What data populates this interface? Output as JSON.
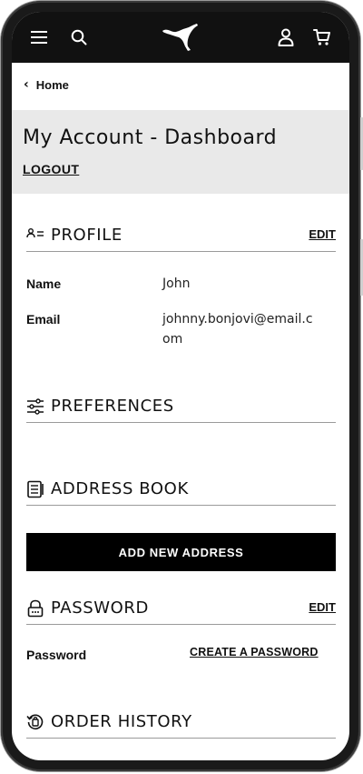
{
  "header": {
    "menu_icon": "hamburger-menu-icon",
    "search_icon": "search-icon",
    "logo_icon": "puma-logo-icon",
    "account_icon": "user-icon",
    "cart_icon": "cart-icon"
  },
  "breadcrumb": {
    "back_icon": "chevron-left-icon",
    "label": "Home"
  },
  "banner": {
    "title": "My Account - Dashboard",
    "logout_label": "LOGOUT"
  },
  "profile": {
    "title": "PROFILE",
    "edit_label": "EDIT",
    "name_label": "Name",
    "name_value": "John",
    "email_label": "Email",
    "email_value": "johnny.bonjovi@email.com"
  },
  "preferences": {
    "title": "PREFERENCES"
  },
  "address_book": {
    "title": "ADDRESS BOOK",
    "add_button_label": "ADD NEW ADDRESS"
  },
  "password": {
    "title": "PASSWORD",
    "edit_label": "EDIT",
    "password_label": "Password",
    "create_label": "CREATE A PASSWORD"
  },
  "order_history": {
    "title": "ORDER HISTORY"
  },
  "colors": {
    "topbar": "#111111",
    "banner": "#e9e9e9",
    "button": "#000000",
    "divider": "#9a9a9a"
  }
}
